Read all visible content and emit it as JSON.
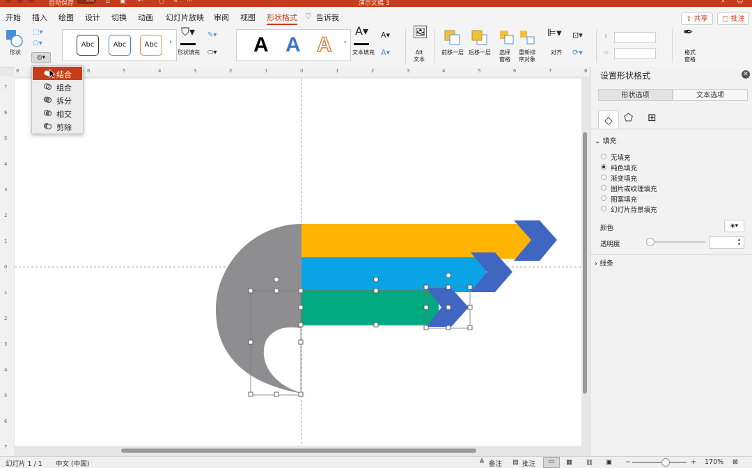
{
  "titlebar": {
    "autosave_label": "自动保存",
    "autosave_state": "关闭",
    "doc_title": "演示文稿 3"
  },
  "tabs": [
    {
      "label": "开始"
    },
    {
      "label": "插入"
    },
    {
      "label": "绘图"
    },
    {
      "label": "设计"
    },
    {
      "label": "切换"
    },
    {
      "label": "动画"
    },
    {
      "label": "幻灯片放映"
    },
    {
      "label": "审阅"
    },
    {
      "label": "视图"
    },
    {
      "label": "形状格式",
      "active": true
    },
    {
      "label": "告诉我"
    }
  ],
  "share_button": "共享",
  "comments_button": "批注",
  "ribbon": {
    "shape_label": "形状",
    "style_samples": [
      "Abc",
      "Abc",
      "Abc"
    ],
    "shape_fill_label": "形状填充",
    "wordart_letters": [
      "A",
      "A",
      "A"
    ],
    "text_fill_label": "文本填充",
    "alt_text_label": "Alt\n文本",
    "bring_forward_label": "前移一层",
    "send_backward_label": "后移一层",
    "selection_pane_label": "选择\n窗格",
    "reorder_label": "重新排\n序对象",
    "align_label": "对齐",
    "format_pane_label": "格式\n窗格"
  },
  "merge_menu": [
    {
      "label": "结合",
      "highlighted": true,
      "icon": "union-icon"
    },
    {
      "label": "组合",
      "icon": "combine-icon"
    },
    {
      "label": "拆分",
      "icon": "fragment-icon"
    },
    {
      "label": "相交",
      "icon": "intersect-icon"
    },
    {
      "label": "剪除",
      "icon": "subtract-icon"
    }
  ],
  "ruler": {
    "h_ticks": [
      "8",
      "7",
      "6",
      "5",
      "4",
      "3",
      "2",
      "1",
      "0",
      "1",
      "2",
      "3",
      "4",
      "5",
      "6",
      "7",
      "8"
    ],
    "v_ticks": [
      "7",
      "6",
      "5",
      "4",
      "3",
      "2",
      "1",
      "0",
      "1",
      "2",
      "3",
      "4",
      "5",
      "6",
      "7"
    ]
  },
  "slide_colors": {
    "yellow": "#ffb400",
    "blue": "#0aa3e6",
    "green": "#00a97f",
    "arrow": "#3f66c0",
    "gray": "#8e8d90"
  },
  "panel": {
    "title": "设置形状格式",
    "tabs": [
      "形状选项",
      "文本选项"
    ],
    "fill_section": "填充",
    "fill_options": [
      {
        "label": "无填充",
        "selected": false
      },
      {
        "label": "纯色填充",
        "selected": true
      },
      {
        "label": "渐变填充",
        "selected": false
      },
      {
        "label": "图片或纹理填充",
        "selected": false
      },
      {
        "label": "图案填充",
        "selected": false
      },
      {
        "label": "幻灯片背景填充",
        "selected": false
      }
    ],
    "color_label": "颜色",
    "transparency_label": "透明度",
    "transparency_value": "",
    "line_section": "线条"
  },
  "status": {
    "slide_info": "幻灯片 1 / 1",
    "language": "中文 (中国)",
    "notes": "备注",
    "comments": "批注",
    "zoom": "170%"
  }
}
